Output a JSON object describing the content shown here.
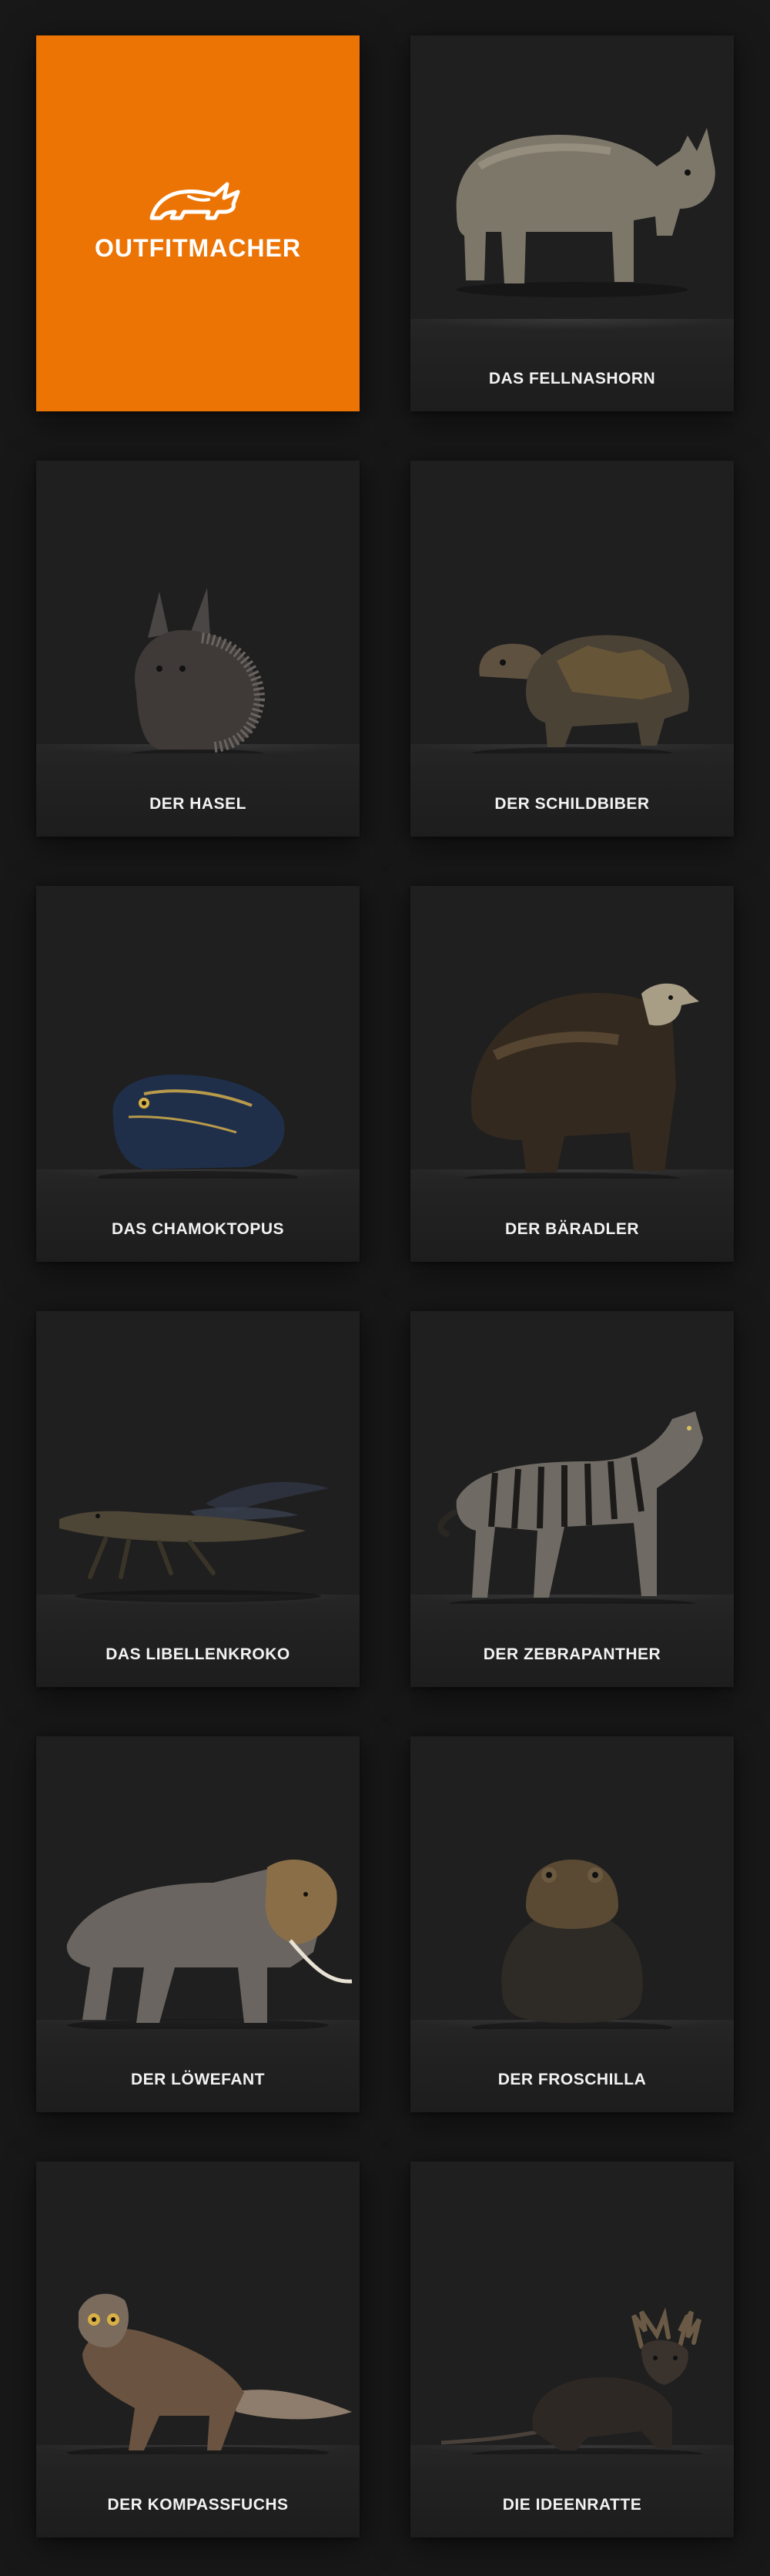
{
  "brand": {
    "name": "OUTFITMACHER",
    "color": "#ec7404",
    "icon": "rhino-logo-icon"
  },
  "cards": [
    {
      "title": "DAS FELLNASHORN",
      "icon": "rhino-icon"
    },
    {
      "title": "DER HASEL",
      "icon": "hedgehog-rabbit-icon"
    },
    {
      "title": "DER SCHILDBIBER",
      "icon": "turtle-beaver-icon"
    },
    {
      "title": "DAS CHAMOKTOPUS",
      "icon": "chameleon-octopus-icon"
    },
    {
      "title": "DER BÄRADLER",
      "icon": "bear-eagle-icon"
    },
    {
      "title": "DAS LIBELLENKROKO",
      "icon": "dragonfly-crocodile-icon"
    },
    {
      "title": "DER ZEBRAPANTHER",
      "icon": "zebra-panther-icon"
    },
    {
      "title": "DER LÖWEFANT",
      "icon": "lion-elephant-icon"
    },
    {
      "title": "DER FROSCHILLA",
      "icon": "frog-gorilla-icon"
    },
    {
      "title": "DER KOMPASSFUCHS",
      "icon": "owl-fox-icon"
    },
    {
      "title": "DIE IDEENRATTE",
      "icon": "moose-rat-icon"
    }
  ]
}
